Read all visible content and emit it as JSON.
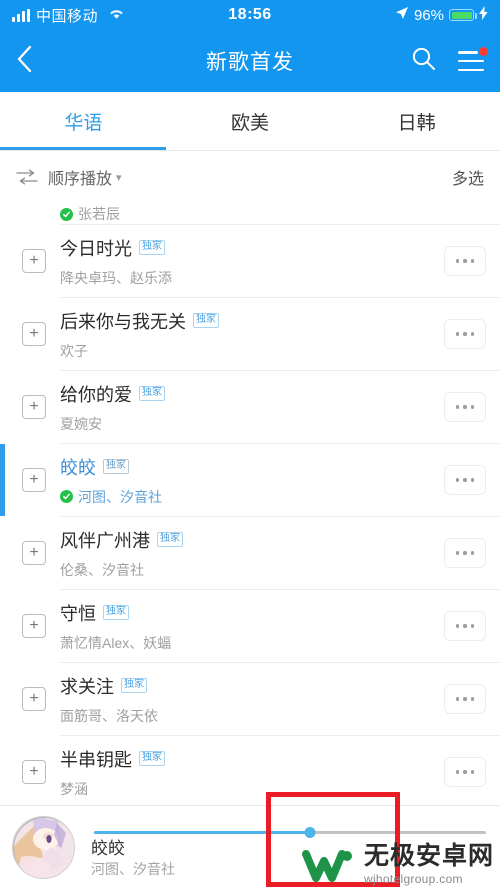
{
  "status_bar": {
    "carrier": "中国移动",
    "time": "18:56",
    "battery_percent": "96%",
    "signal_icon": "signal-bars-icon",
    "wifi_icon": "wifi-icon",
    "location_icon": "location-arrow-icon",
    "charging_icon": "lightning-bolt-icon",
    "battery_icon": "battery-icon"
  },
  "nav": {
    "back_icon": "chevron-left-icon",
    "title": "新歌首发",
    "search_icon": "search-icon",
    "menu_icon": "hamburger-menu-icon"
  },
  "tabs": [
    {
      "label": "华语",
      "active": true
    },
    {
      "label": "欧美",
      "active": false
    },
    {
      "label": "日韩",
      "active": false
    }
  ],
  "control_row": {
    "play_mode_icon": "sequence-play-icon",
    "play_mode_label": "顺序播放",
    "caret_icon": "chevron-down-icon",
    "multi_select_label": "多选"
  },
  "list": {
    "clipped_top_row": {
      "artist": "张若辰",
      "verified": true
    },
    "rows": [
      {
        "title": "今日时光",
        "tag": "独家",
        "artist": "降央卓玛、赵乐添",
        "verified": false,
        "playing": false
      },
      {
        "title": "后来你与我无关",
        "tag": "独家",
        "artist": "欢子",
        "verified": false,
        "playing": false
      },
      {
        "title": "给你的爱",
        "tag": "独家",
        "artist": "夏婉安",
        "verified": false,
        "playing": false
      },
      {
        "title": "皎皎",
        "tag": "独家",
        "artist": "河图、汐音社",
        "verified": true,
        "playing": true
      },
      {
        "title": "风伴广州港",
        "tag": "独家",
        "artist": "伦桑、汐音社",
        "verified": false,
        "playing": false
      },
      {
        "title": "守恒",
        "tag": "独家",
        "artist": "萧忆情Alex、妖蝠",
        "verified": false,
        "playing": false
      },
      {
        "title": "求关注",
        "tag": "独家",
        "artist": "面筋哥、洛天依",
        "verified": false,
        "playing": false
      },
      {
        "title": "半串钥匙",
        "tag": "独家",
        "artist": "梦涵",
        "verified": false,
        "playing": false
      }
    ],
    "add_icon": "plus-square-icon",
    "more_icon": "more-dots-icon",
    "verified_icon": "verified-check-icon"
  },
  "player": {
    "cover_icon": "album-cover-art",
    "title": "皎皎",
    "artist": "河图、汐音社",
    "progress_percent": 55
  },
  "watermark": {
    "name": "无极安卓网",
    "url": "wjhotelgroup.com",
    "logo_icon": "w-logo-icon"
  },
  "annotation": {
    "shape": "red-rectangle-highlight"
  },
  "colors": {
    "brand_blue": "#1296f0",
    "accent_blue": "#2e9ce8",
    "annotation_red": "#ec1c24",
    "verified_green": "#24c04a"
  }
}
